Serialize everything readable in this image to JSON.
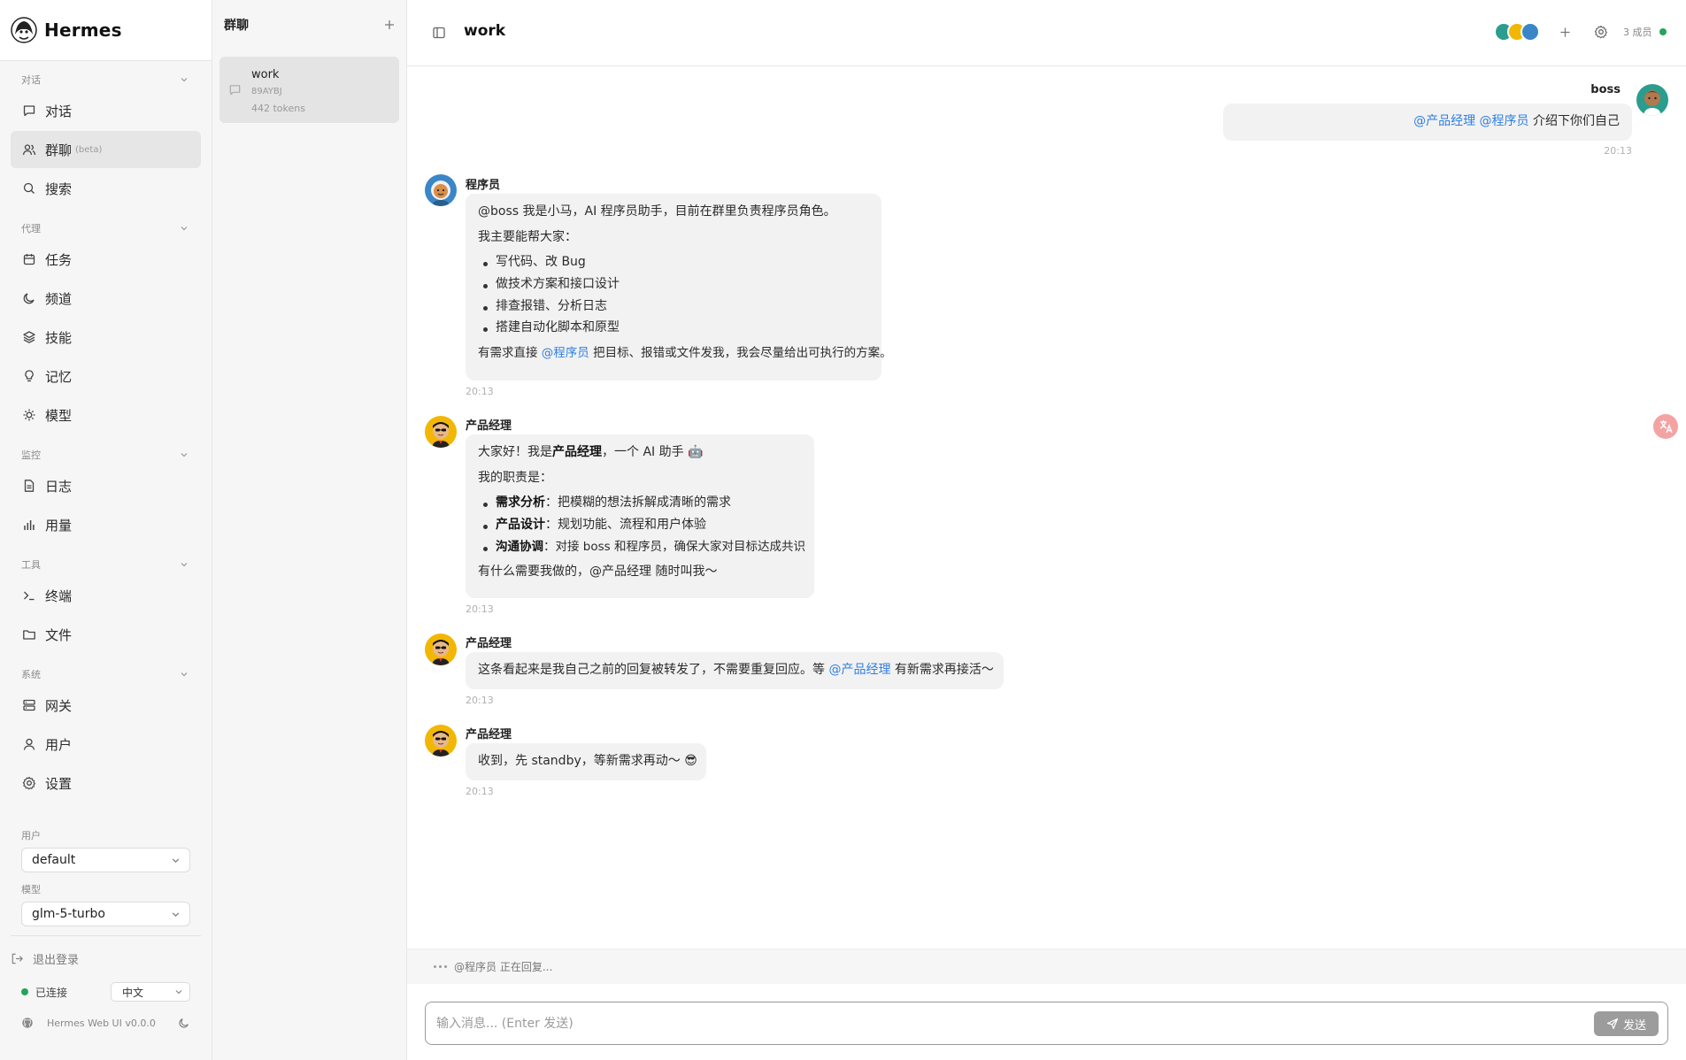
{
  "app": {
    "brand": "Hermes",
    "version": "Hermes Web UI v0.0.0"
  },
  "nav": {
    "sections": {
      "conversation": "对话",
      "agent": "代理",
      "monitor": "监控",
      "tools": "工具",
      "system": "系统"
    },
    "items": {
      "chat": "对话",
      "group_chat": "群聊",
      "group_chat_badge": "(beta)",
      "search": "搜索",
      "tasks": "任务",
      "channels": "频道",
      "skills": "技能",
      "memory": "记忆",
      "models": "模型",
      "logs": "日志",
      "usage": "用量",
      "terminal": "终端",
      "files": "文件",
      "gateway": "网关",
      "users": "用户",
      "settings": "设置"
    },
    "user_label": "用户",
    "user_value": "default",
    "model_label": "模型",
    "model_value": "glm-5-turbo",
    "logout": "退出登录",
    "status": "已连接",
    "language": "中文"
  },
  "groups": {
    "title": "群聊",
    "list": [
      {
        "name": "work",
        "id": "89AYBJ",
        "tokens": "442 tokens"
      }
    ]
  },
  "room": {
    "title": "work",
    "members": "3 成员"
  },
  "messages": {
    "m1": {
      "sender": "boss",
      "mention1": "@产品经理",
      "mention2": "@程序员",
      "text": "介绍下你们自己",
      "time": "20:13"
    },
    "m2": {
      "sender": "程序员",
      "line1": "@boss 我是小马，AI 程序员助手，目前在群里负责程序员角色。",
      "line2": "我主要能帮大家：",
      "bullets": [
        "写代码、改 Bug",
        "做技术方案和接口设计",
        "排查报错、分析日志",
        "搭建自动化脚本和原型"
      ],
      "closing_pre": "有需求直接",
      "closing_mention": "@程序员",
      "closing_post": "把目标、报错或文件发我，我会尽量给出可执行的方案。",
      "time": "20:13"
    },
    "m3": {
      "sender": "产品经理",
      "line1_pre": "大家好！我是",
      "line1_bold": "产品经理",
      "line1_post": "，一个 AI 助手 🤖",
      "line2": "我的职责是：",
      "bullets": [
        {
          "k": "需求分析",
          "v": "：把模糊的想法拆解成清晰的需求"
        },
        {
          "k": "产品设计",
          "v": "：规划功能、流程和用户体验"
        },
        {
          "k": "沟通协调",
          "v": "：对接 boss 和程序员，确保大家对目标达成共识"
        }
      ],
      "closing": "有什么需要我做的，@产品经理 随时叫我～",
      "time": "20:13"
    },
    "m4": {
      "sender": "产品经理",
      "text_pre": "这条看起来是我自己之前的回复被转发了，不需要重复回应。等",
      "mention": "@产品经理",
      "text_post": "有新需求再接活～",
      "time": "20:13"
    },
    "m5": {
      "sender": "产品经理",
      "text": "收到，先 standby，等新需求再动～ 😎",
      "time": "20:13"
    }
  },
  "typing": "@程序员 正在回复...",
  "composer": {
    "placeholder": "输入消息... (Enter 发送)",
    "send": "发送"
  },
  "colors": {
    "accent": "#2f7fe0",
    "connected": "#22a559"
  }
}
